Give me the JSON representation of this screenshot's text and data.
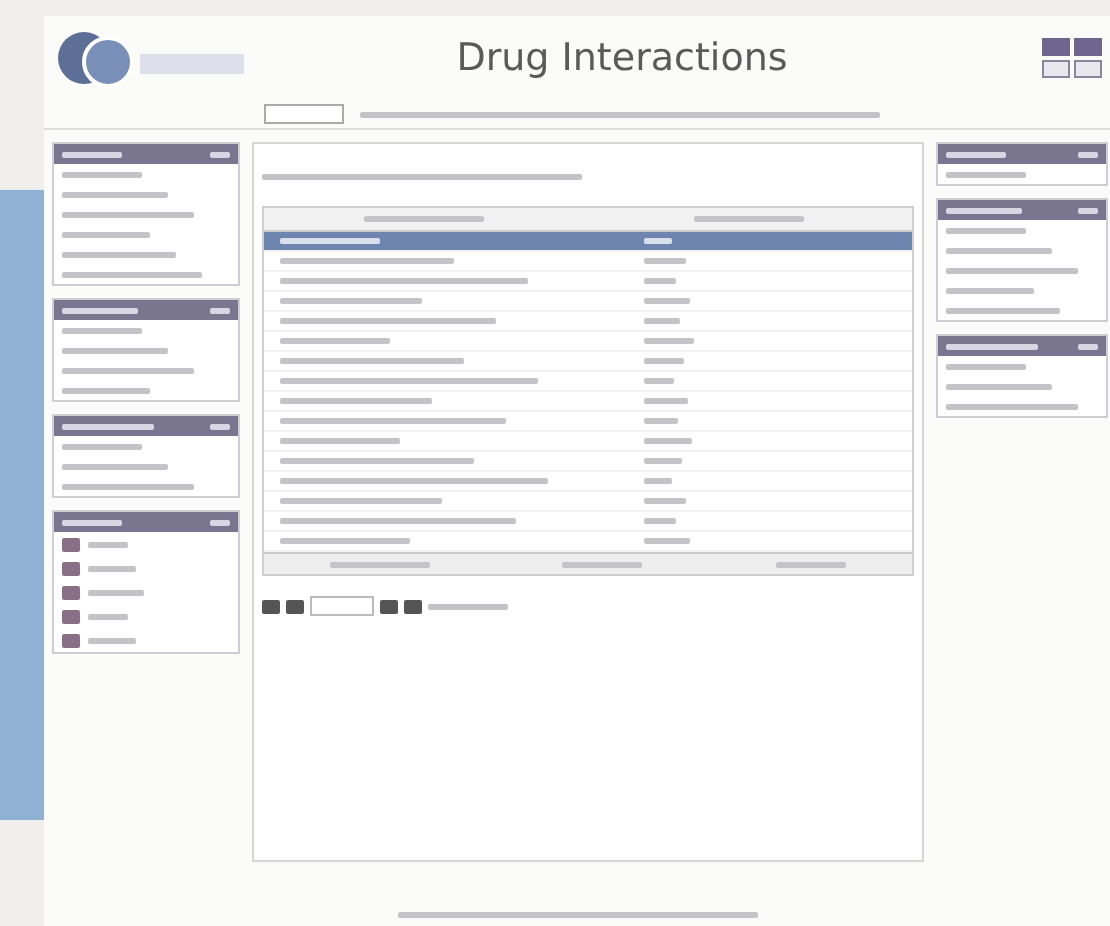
{
  "header": {
    "title": "Drug Interactions"
  },
  "left_panels": [
    {
      "items": [
        {
          "kind": "link"
        },
        {
          "kind": "link"
        },
        {
          "kind": "link"
        },
        {
          "kind": "link"
        },
        {
          "kind": "link"
        },
        {
          "kind": "link"
        }
      ]
    },
    {
      "items": [
        {
          "kind": "link"
        },
        {
          "kind": "link"
        },
        {
          "kind": "link"
        },
        {
          "kind": "link"
        }
      ]
    },
    {
      "items": [
        {
          "kind": "link"
        },
        {
          "kind": "link"
        },
        {
          "kind": "link"
        }
      ]
    },
    {
      "items": [
        {
          "kind": "icon"
        },
        {
          "kind": "icon"
        },
        {
          "kind": "icon"
        },
        {
          "kind": "icon"
        },
        {
          "kind": "icon"
        }
      ]
    }
  ],
  "right_panels": [
    {
      "items": [
        {
          "kind": "link"
        }
      ]
    },
    {
      "items": [
        {
          "kind": "link"
        },
        {
          "kind": "link"
        },
        {
          "kind": "link"
        },
        {
          "kind": "link"
        },
        {
          "kind": "link"
        }
      ]
    },
    {
      "items": [
        {
          "kind": "link"
        },
        {
          "kind": "link"
        },
        {
          "kind": "link"
        }
      ]
    }
  ],
  "table": {
    "rows": [
      {
        "selected": true
      },
      {
        "selected": false
      },
      {
        "selected": false
      },
      {
        "selected": false
      },
      {
        "selected": false
      },
      {
        "selected": false
      },
      {
        "selected": false
      },
      {
        "selected": false
      },
      {
        "selected": false
      },
      {
        "selected": false
      },
      {
        "selected": false
      },
      {
        "selected": false
      },
      {
        "selected": false
      },
      {
        "selected": false
      },
      {
        "selected": false
      },
      {
        "selected": false
      }
    ]
  }
}
